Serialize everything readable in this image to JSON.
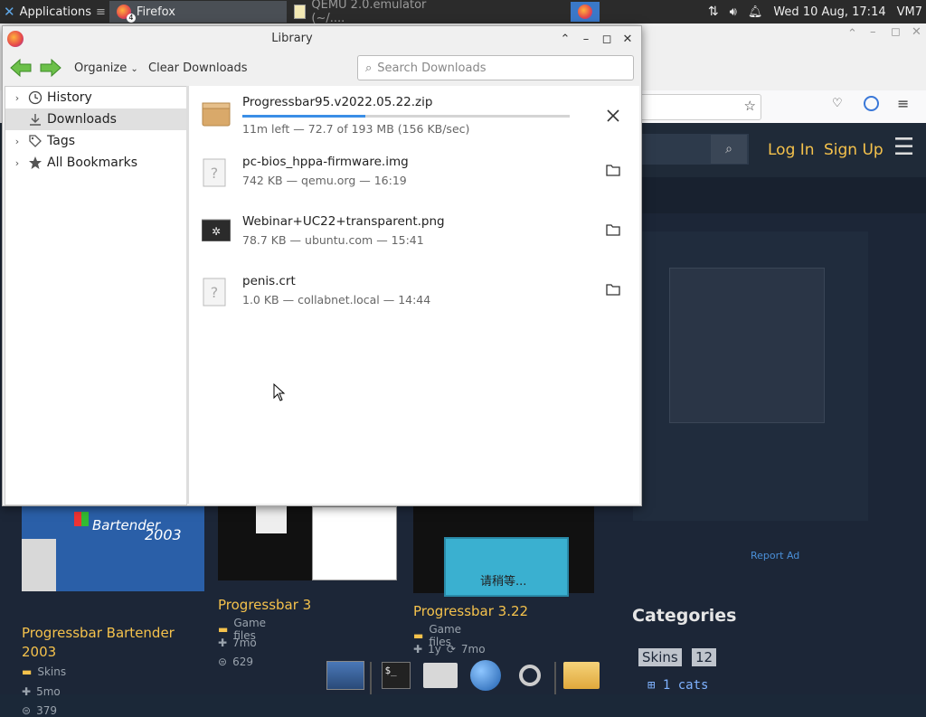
{
  "panel": {
    "applications_label": "Applications",
    "firefox_task_label": "Firefox",
    "firefox_badge": "4",
    "qemu_task_label": "QEMU 2.0.emulator (~/....",
    "clock": "Wed 10 Aug, 17:14",
    "user": "VM7"
  },
  "website": {
    "login_label": "Log In",
    "signup_label": "Sign Up",
    "report_ad": "Report Ad",
    "categories_title": "Categories",
    "category_skins": "Skins",
    "category_skins_count": "12",
    "category_sub": "1 cats",
    "cards": [
      {
        "title": "Progressbar Bartender 2003",
        "category": "Skins",
        "age": "5mo",
        "downloads": "379",
        "thumb_text": "Bartender",
        "thumb_year": "2003"
      },
      {
        "title": "Progressbar 3",
        "category": "Game files",
        "age": "7mo",
        "downloads": "629"
      },
      {
        "title": "Progressbar 3.22",
        "category": "Game files",
        "age": "1y",
        "age2": "7mo",
        "thumb_text": "请稍等..."
      }
    ]
  },
  "library": {
    "title": "Library",
    "toolbar": {
      "organize_label": "Organize",
      "clear_downloads_label": "Clear Downloads",
      "search_placeholder": "Search Downloads"
    },
    "sidebar": {
      "items": [
        {
          "label": "History",
          "icon": "clock-icon",
          "expandable": true
        },
        {
          "label": "Downloads",
          "icon": "download-icon",
          "selected": true
        },
        {
          "label": "Tags",
          "icon": "tag-icon",
          "expandable": true
        },
        {
          "label": "All Bookmarks",
          "icon": "star-icon",
          "expandable": true
        }
      ]
    },
    "downloads": [
      {
        "name": "Progressbar95.v2022.05.22.zip",
        "status": "11m left — 72.7 of 193 MB (156 KB/sec)",
        "progress": 0.376,
        "in_progress": true,
        "icon": "archive-icon"
      },
      {
        "name": "pc-bios_hppa-firmware.img",
        "status": "742 KB — qemu.org — 16:19",
        "icon": "unknown-file-icon"
      },
      {
        "name": "Webinar+UC22+transparent.png",
        "status": "78.7 KB — ubuntu.com — 15:41",
        "icon": "image-file-icon"
      },
      {
        "name": "penis.crt",
        "status": "1.0 KB — collabnet.local — 14:44",
        "icon": "unknown-file-icon"
      }
    ]
  },
  "colors": {
    "accent_blue": "#3a8ee6",
    "site_link_yellow": "#f5c24c",
    "site_background": "#1c2637"
  }
}
